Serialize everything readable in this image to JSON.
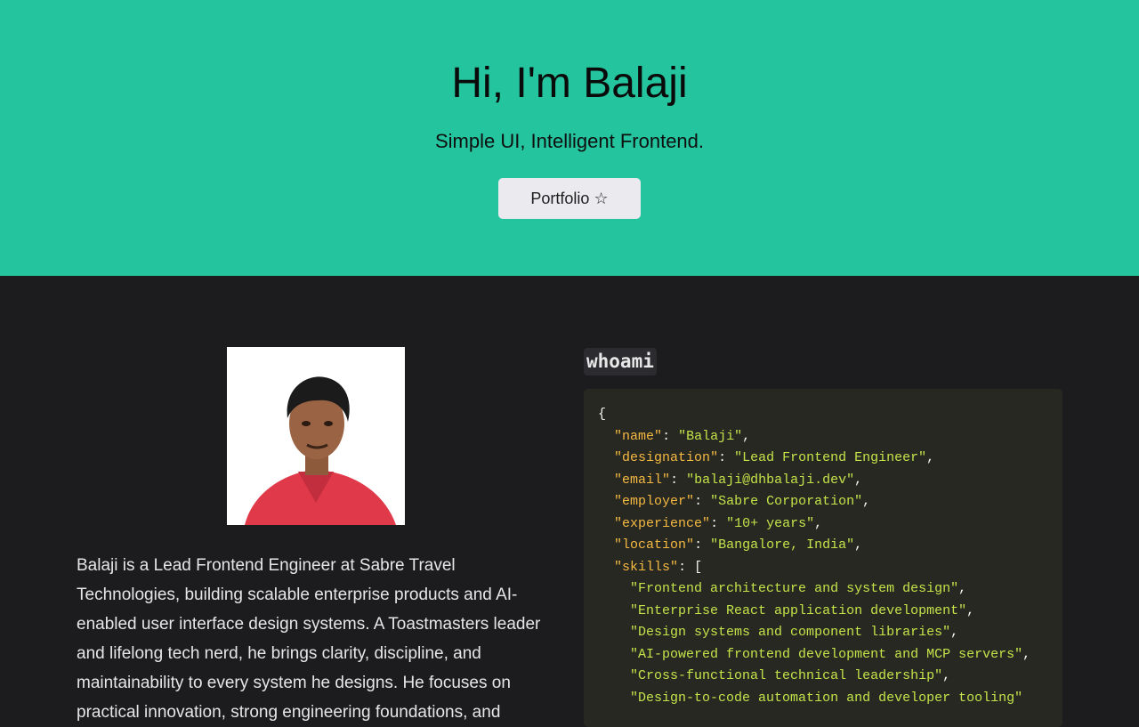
{
  "hero": {
    "title": "Hi, I'm Balaji",
    "tagline": "Simple UI, Intelligent Frontend.",
    "button_label": "Portfolio ☆"
  },
  "about": {
    "bio": "Balaji is a Lead Frontend Engineer at Sabre Travel Technologies, building scalable enterprise products and AI-enabled user interface design systems. A Toastmasters leader and lifelong tech nerd, he brings clarity, discipline, and maintainability to every system he designs. He focuses on practical innovation, strong engineering foundations, and"
  },
  "whoami": {
    "heading": "whoami",
    "fields": [
      {
        "key": "name",
        "value": "Balaji"
      },
      {
        "key": "designation",
        "value": "Lead Frontend Engineer"
      },
      {
        "key": "email",
        "value": "balaji@dhbalaji.dev"
      },
      {
        "key": "employer",
        "value": "Sabre Corporation"
      },
      {
        "key": "experience",
        "value": "10+ years"
      },
      {
        "key": "location",
        "value": "Bangalore, India"
      }
    ],
    "skills_key": "skills",
    "skills": [
      "Frontend architecture and system design",
      "Enterprise React application development",
      "Design systems and component libraries",
      "AI-powered frontend development and MCP servers",
      "Cross-functional technical leadership",
      "Design-to-code automation and developer tooling"
    ]
  },
  "colors": {
    "hero_bg": "#23c49e",
    "page_bg": "#1c1b1e",
    "code_bg": "#272822",
    "json_key": "#f5b942",
    "json_string": "#c4e34a"
  }
}
